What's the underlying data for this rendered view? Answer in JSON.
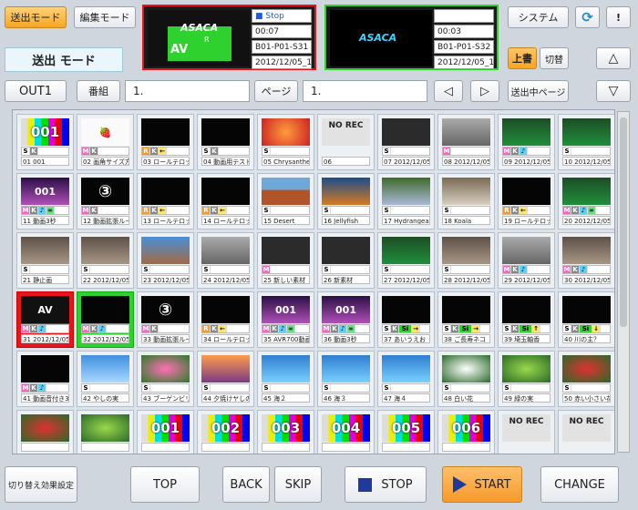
{
  "header": {
    "send_mode": "送出モード",
    "edit_mode": "編集モード",
    "mode_title": "送出 モード",
    "system": "システム",
    "refresh_icon": "refresh-icon",
    "alert": "!",
    "overwrite": "上書",
    "switch": "切替"
  },
  "monitor_left": {
    "status": "■ Stop",
    "time": "00:07",
    "clip": "B01-P01-S31",
    "date": "2012/12/05_15",
    "overlay_logo": "ASACA",
    "overlay_av": "AV",
    "overlay_r": "R"
  },
  "monitor_right": {
    "time": "00:03",
    "clip": "B01-P01-S32",
    "date": "2012/12/05_16",
    "overlay_logo": "ASACA"
  },
  "toolbar": {
    "output": "OUT1",
    "program_label": "番組",
    "program_value": "1.",
    "page_label": "ページ",
    "page_value": "1.",
    "prev_icon": "◁",
    "next_icon": "▷",
    "on_air_page": "送出中ページ",
    "up_icon": "△",
    "down_icon": "▽"
  },
  "cells": [
    {
      "t": "01 001",
      "th": "001",
      "k": "bars",
      "m": "SK"
    },
    {
      "t": "02 画角サイズ方",
      "th": "🍓",
      "k": "white",
      "m": "MK"
    },
    {
      "t": "03 ロールテロッ",
      "th": "",
      "k": "black",
      "m": "RK←"
    },
    {
      "t": "04 動画用テスト",
      "th": "",
      "k": "black",
      "m": "SK"
    },
    {
      "t": "05 Chrysanther",
      "th": "",
      "k": "flower",
      "m": "S"
    },
    {
      "t": "06",
      "th": "NO REC",
      "k": "norec",
      "m": ""
    },
    {
      "t": "07 2012/12/05",
      "th": "",
      "k": "dark",
      "m": "S"
    },
    {
      "t": "08 2012/12/05",
      "th": "",
      "k": "gray",
      "m": "M"
    },
    {
      "t": "09 2012/12/05",
      "th": "",
      "k": "stadium",
      "m": "MK♪"
    },
    {
      "t": "10 2012/12/05",
      "th": "",
      "k": "stadium",
      "m": "S"
    },
    {
      "t": "11 動画3秒",
      "th": "001",
      "k": "purple",
      "m": "MK♪∞"
    },
    {
      "t": "12 動画拡張ル−",
      "th": "③",
      "k": "black",
      "m": "MK"
    },
    {
      "t": "13 ロールテロッ",
      "th": "",
      "k": "black",
      "m": "RK←"
    },
    {
      "t": "14 ロールテロッ",
      "th": "",
      "k": "black",
      "m": "RK←"
    },
    {
      "t": "15 Desert",
      "th": "",
      "k": "desert",
      "m": "S"
    },
    {
      "t": "16 Jellyfish",
      "th": "",
      "k": "jelly",
      "m": "S"
    },
    {
      "t": "17 Hydrangeas",
      "th": "",
      "k": "hyd",
      "m": "S"
    },
    {
      "t": "18 Koala",
      "th": "",
      "k": "koala",
      "m": "S"
    },
    {
      "t": "19 ロールテロッ",
      "th": "",
      "k": "black",
      "m": "RK←"
    },
    {
      "t": "20 2012/12/05",
      "th": "",
      "k": "stadium",
      "m": "MK♪∞"
    },
    {
      "t": "21 静止画",
      "th": "",
      "k": "street",
      "m": "S"
    },
    {
      "t": "22 2012/12/05",
      "th": "",
      "k": "street",
      "m": "S"
    },
    {
      "t": "23 2012/12/05",
      "th": "",
      "k": "sky",
      "m": "S"
    },
    {
      "t": "24 2012/12/05",
      "th": "",
      "k": "gray",
      "m": "S"
    },
    {
      "t": "25 新しい素材",
      "th": "",
      "k": "dark",
      "m": "M"
    },
    {
      "t": "26 新素材",
      "th": "",
      "k": "dark",
      "m": "S"
    },
    {
      "t": "27 2012/12/05",
      "th": "",
      "k": "stadium",
      "m": "S"
    },
    {
      "t": "28 2012/12/05",
      "th": "",
      "k": "street",
      "m": "S"
    },
    {
      "t": "29 2012/12/05",
      "th": "",
      "k": "gray",
      "m": "MK♪"
    },
    {
      "t": "30 2012/12/05",
      "th": "",
      "k": "street",
      "m": "MK♪"
    },
    {
      "t": "31 2012/12/05",
      "th": "AV",
      "k": "green",
      "m": "MK♪",
      "sel": "red"
    },
    {
      "t": "32 2012/12/05",
      "th": "",
      "k": "black",
      "m": "MK♪",
      "sel": "grn"
    },
    {
      "t": "33 動画拡張ル−",
      "th": "③",
      "k": "black",
      "m": "MK"
    },
    {
      "t": "34 ロールテロッ",
      "th": "",
      "k": "black",
      "m": "RK←"
    },
    {
      "t": "35 AVR700動画",
      "th": "001",
      "k": "purple",
      "m": "MK♪∞"
    },
    {
      "t": "36 動画3秒",
      "th": "001",
      "k": "purple",
      "m": "MK♪∞"
    },
    {
      "t": "37 あいうえお",
      "th": "",
      "k": "black",
      "m": "SKSi→"
    },
    {
      "t": "38 ご長寿ネコ",
      "th": "",
      "k": "black",
      "m": "SKSi→"
    },
    {
      "t": "39 埼玉軸香",
      "th": "",
      "k": "black",
      "m": "SKSi↑"
    },
    {
      "t": "40 川の主？",
      "th": "",
      "k": "black",
      "m": "SKSi↓"
    },
    {
      "t": "41 動画音付き3",
      "th": "",
      "k": "black",
      "m": "MK♪"
    },
    {
      "t": "42 やしの実",
      "th": "",
      "k": "beach",
      "m": "S"
    },
    {
      "t": "43 ブーゲンビリ",
      "th": "",
      "k": "pinkfl",
      "m": "S"
    },
    {
      "t": "44 夕焼けヤしの",
      "th": "",
      "k": "sunset",
      "m": "S"
    },
    {
      "t": "45 海２",
      "th": "",
      "k": "sea",
      "m": "S"
    },
    {
      "t": "46 海３",
      "th": "",
      "k": "sea",
      "m": "S"
    },
    {
      "t": "47 海４",
      "th": "",
      "k": "sea",
      "m": "S"
    },
    {
      "t": "48 白い花",
      "th": "",
      "k": "whitefl",
      "m": "S"
    },
    {
      "t": "49 緑の実",
      "th": "",
      "k": "greenfl",
      "m": "S"
    },
    {
      "t": "50 赤い小さい花",
      "th": "",
      "k": "redfl",
      "m": "S"
    },
    {
      "t": "",
      "th": "",
      "k": "redfl",
      "m": ""
    },
    {
      "t": "",
      "th": "",
      "k": "greenfl",
      "m": ""
    },
    {
      "t": "",
      "th": "001",
      "k": "bars",
      "m": ""
    },
    {
      "t": "",
      "th": "002",
      "k": "bars",
      "m": ""
    },
    {
      "t": "",
      "th": "003",
      "k": "bars",
      "m": ""
    },
    {
      "t": "",
      "th": "004",
      "k": "bars",
      "m": ""
    },
    {
      "t": "",
      "th": "005",
      "k": "bars",
      "m": ""
    },
    {
      "t": "",
      "th": "006",
      "k": "bars",
      "m": ""
    },
    {
      "t": "",
      "th": "NO REC",
      "k": "norec",
      "m": ""
    },
    {
      "t": "",
      "th": "NO REC",
      "k": "norec",
      "m": ""
    }
  ],
  "footer": {
    "effect": "切り替え効果設定",
    "top": "TOP",
    "back": "BACK",
    "skip": "SKIP",
    "stop": "STOP",
    "start": "START",
    "change": "CHANGE"
  },
  "colors": {
    "accent": "#f5a623",
    "red_frame": "#e8141c",
    "green_frame": "#2fd12f",
    "start_bg": "#f7a53a"
  }
}
